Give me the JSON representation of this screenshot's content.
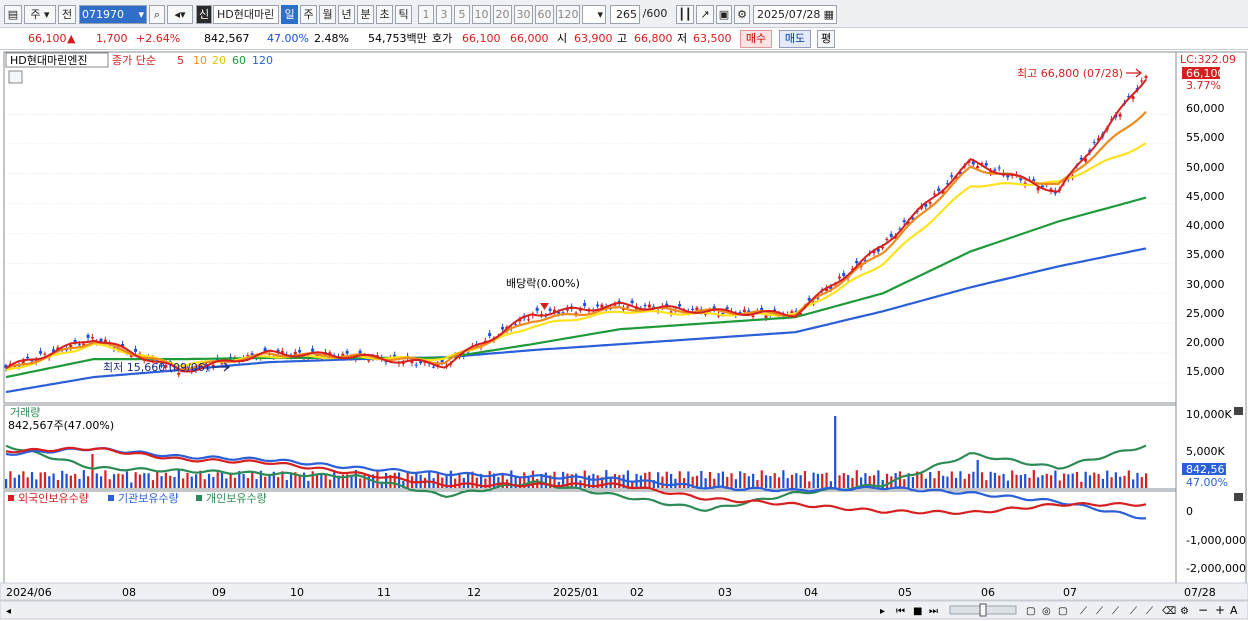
{
  "toolbar": {
    "period_type": "주",
    "prev_label": "전",
    "stock_code": "071970",
    "new_badge": "신",
    "stock_name": "HD현대마린",
    "period_buttons": [
      "일",
      "주",
      "월",
      "년",
      "분",
      "초",
      "틱"
    ],
    "period_active": "일",
    "interval_buttons": [
      "1",
      "3",
      "5",
      "10",
      "20",
      "30",
      "60",
      "120"
    ],
    "count_value": "265",
    "count_max": "/600",
    "date_value": "2025/07/28"
  },
  "quote": {
    "price": "66,100",
    "change_arrow": "▲",
    "change": "1,700",
    "change_pct": "+2.64%",
    "volume": "842,567",
    "volume_ratio": "47.00%",
    "turnover_rate": "2.48%",
    "trade_value": "54,753백만",
    "ask_label": "호가",
    "ask_price": "66,100",
    "bid_price": "66,000",
    "open_label": "시",
    "open": "63,900",
    "high_label": "고",
    "high": "66,800",
    "low_label": "저",
    "low": "63,500",
    "buy_button": "매수",
    "sell_button": "매도",
    "eval_button": "평"
  },
  "price_panel": {
    "stock_label": "HD현대마린엔진",
    "ma_title": "종가 단순",
    "ma_periods": [
      "5",
      "10",
      "20",
      "60",
      "120"
    ],
    "ma_colors": [
      "#d62020",
      "#f08a1c",
      "#ffe21c",
      "#1e9a3a",
      "#2a5fd8"
    ],
    "lc_label": "LC:322.09",
    "current_price_tag": "66,100",
    "current_pct_tag": "3.77%",
    "high_annotation": "최고 66,800 (07/28)",
    "low_annotation": "최저 15,660 (09/06)",
    "dividend_annotation": "배당락(0.00%)",
    "y_ticks": [
      "60,000",
      "55,000",
      "50,000",
      "45,000",
      "40,000",
      "35,000",
      "30,000",
      "25,000",
      "20,000",
      "15,000"
    ]
  },
  "volume_panel": {
    "title": "거래량",
    "value_label": "842,567주(47.00%)",
    "y_ticks": [
      "10,000K",
      "5,000K"
    ],
    "tag_value": "842,567",
    "tag_pct": "47.00%"
  },
  "holdings_panel": {
    "legend": [
      "외국인보유수량",
      "기관보유수량",
      "개인보유수량"
    ],
    "legend_colors": [
      "#d62020",
      "#2a5fd8",
      "#2e8b57"
    ],
    "y_ticks": [
      "0",
      "-1,000,000",
      "-2,000,000"
    ]
  },
  "x_axis": {
    "labels": [
      "2024/06",
      "08",
      "09",
      "10",
      "11",
      "12",
      "2025/01",
      "02",
      "03",
      "04",
      "05",
      "06",
      "07"
    ],
    "right_label": "07/28"
  },
  "chart_data": {
    "type": "line",
    "title": "",
    "x": [
      "2024/06",
      "08",
      "09",
      "10",
      "11",
      "12",
      "2025/01",
      "02",
      "03",
      "04",
      "05",
      "06",
      "07",
      "07/28"
    ],
    "series": [
      {
        "name": "5",
        "values": [
          17500,
          22500,
          17000,
          20000,
          19500,
          18000,
          26500,
          28000,
          27000,
          26500,
          38000,
          52000,
          47000,
          66100
        ]
      },
      {
        "name": "10",
        "values": [
          17200,
          22000,
          17500,
          19800,
          19500,
          18500,
          25500,
          27500,
          27000,
          26500,
          37000,
          51000,
          48000,
          60500
        ]
      },
      {
        "name": "20",
        "values": [
          17000,
          21500,
          18000,
          19500,
          19300,
          19000,
          24500,
          27000,
          26500,
          26500,
          35000,
          48000,
          48500,
          55000
        ]
      },
      {
        "name": "60",
        "values": [
          16000,
          19000,
          19000,
          19200,
          19200,
          19200,
          21500,
          24000,
          25000,
          26000,
          30000,
          37000,
          42000,
          46000
        ]
      },
      {
        "name": "120",
        "values": [
          13500,
          16000,
          17200,
          18500,
          19000,
          19300,
          20500,
          21500,
          22500,
          23500,
          27000,
          31000,
          34500,
          37500
        ]
      }
    ],
    "ylim": [
      12000,
      70000
    ],
    "high": {
      "value": 66800,
      "date": "07/28"
    },
    "low": {
      "value": 15660,
      "date": "09/06"
    }
  }
}
